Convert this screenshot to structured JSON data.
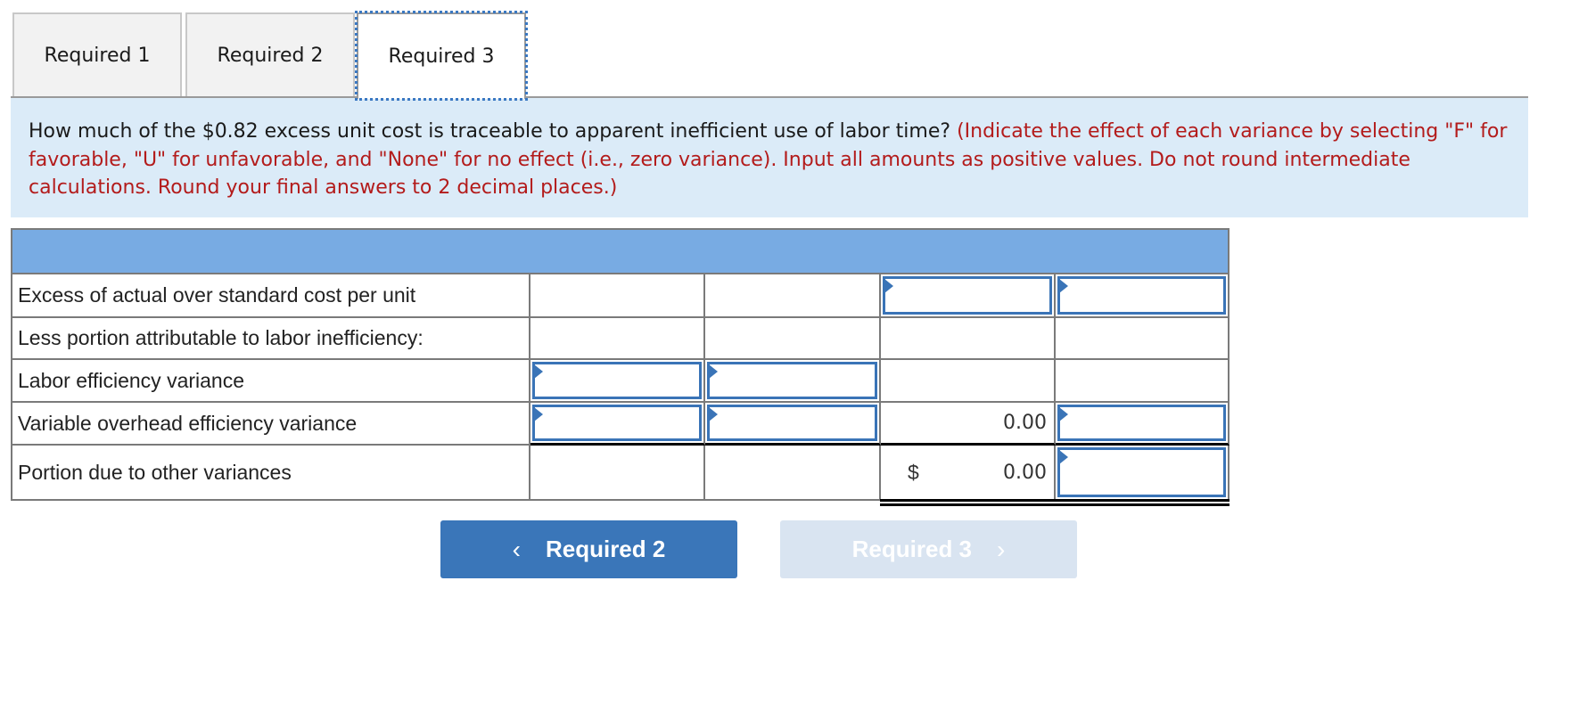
{
  "tabs": [
    {
      "label": "Required 1",
      "active": false
    },
    {
      "label": "Required 2",
      "active": false
    },
    {
      "label": "Required 3",
      "active": true
    }
  ],
  "question": {
    "text": "How much of the $0.82 excess unit cost is traceable to apparent inefficient use of labor time?",
    "instructions": "(Indicate the effect of each variance by selecting \"F\" for favorable, \"U\" for unfavorable, and \"None\" for no effect (i.e., zero variance). Input all amounts as positive values. Do not round intermediate calculations. Round your final answers to 2 decimal places.)"
  },
  "table": {
    "rows": [
      {
        "label": "Excess of actual over standard cost per unit",
        "col1": "",
        "col2": "",
        "col3": "",
        "col4": ""
      },
      {
        "label": "Less portion attributable to labor inefficiency:",
        "col1": "",
        "col2": "",
        "col3": "",
        "col4": ""
      },
      {
        "label": "Labor efficiency variance",
        "col1": "",
        "col2": "",
        "col3": "",
        "col4": ""
      },
      {
        "label": "Variable overhead efficiency variance",
        "col1": "",
        "col2": "",
        "col3": "0.00",
        "col4": ""
      },
      {
        "label": "Portion due to other variances",
        "col1": "",
        "col2": "",
        "col3_prefix": "$",
        "col3": "0.00",
        "col4": ""
      }
    ]
  },
  "nav": {
    "prev_label": "Required 2",
    "next_label": "Required 3",
    "prev_icon": "chevron-left-icon",
    "next_icon": "chevron-right-icon",
    "prev_glyph": "‹",
    "next_glyph": "›"
  },
  "colors": {
    "accent": "#3a76b9",
    "header_fill": "#78abe3",
    "banner_fill": "#dbebf8",
    "instruction_red": "#b31b1b",
    "disabled_button": "#d9e4f1"
  }
}
